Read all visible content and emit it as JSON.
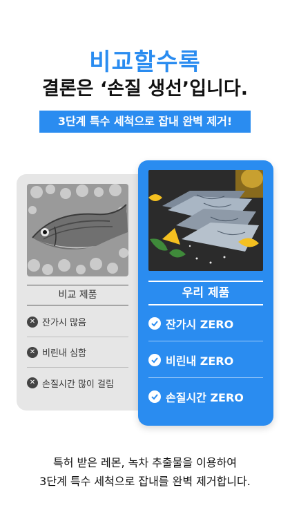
{
  "headline": {
    "line1": "비교할수록",
    "line2": "결론은 ‘손질 생선’입니다."
  },
  "banner": "3단계 특수 세척으로 잡내 완벽 제거!",
  "compare": {
    "title": "비교 제품",
    "items": [
      "잔가시 많음",
      "비린내 심함",
      "손질시간 많이 걸림"
    ],
    "icon": "x-circle-icon",
    "bg_color": "#e6e6e6"
  },
  "ours": {
    "title": "우리 제품",
    "items": [
      "잔가시 ZERO",
      "비린내 ZERO",
      "손질시간 ZERO"
    ],
    "icon": "check-circle-icon",
    "bg_color": "#2a8cf0"
  },
  "footer": {
    "line1": "특허 받은 레몬, 녹차 추출물을 이용하여",
    "line2": "3단계 특수 세척으로 잡내를 완벽 제거합니다."
  },
  "colors": {
    "accent": "#2a8cf0"
  }
}
